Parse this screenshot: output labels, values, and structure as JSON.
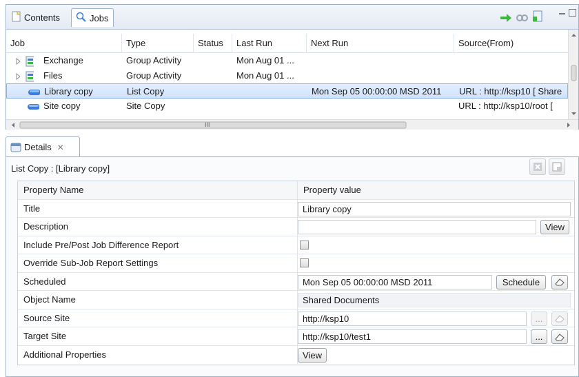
{
  "tabs": {
    "contents": "Contents",
    "jobs": "Jobs"
  },
  "columns": [
    "Job",
    "Type",
    "Status",
    "Last Run",
    "Next Run",
    "Source(From)"
  ],
  "rows": [
    {
      "job": "Exchange",
      "type": "Group Activity",
      "status": "",
      "last_run": "Mon Aug 01 ...",
      "next_run": "",
      "source": ""
    },
    {
      "job": "Files",
      "type": "Group Activity",
      "status": "",
      "last_run": "Mon Aug 01 ...",
      "next_run": "",
      "source": ""
    },
    {
      "job": "Library copy",
      "type": "List Copy",
      "status": "",
      "last_run": "",
      "next_run": "Mon Sep 05 00:00:00 MSD 2011",
      "source": "URL : http://ksp10 [ Share"
    },
    {
      "job": "Site copy",
      "type": "Site Copy",
      "status": "",
      "last_run": "",
      "next_run": "",
      "source": "URL : http://ksp10/root ["
    }
  ],
  "hscroll_mark": "III",
  "details": {
    "tab_label": "Details",
    "header": "List Copy : [Library copy]",
    "col_name": "Property Name",
    "col_value": "Property value",
    "props": {
      "title": {
        "name": "Title",
        "value": "Library copy"
      },
      "description": {
        "name": "Description",
        "value": "",
        "button": "View"
      },
      "include_diff": {
        "name": "Include Pre/Post Job Difference Report"
      },
      "override_sub": {
        "name": "Override Sub-Job Report Settings"
      },
      "scheduled": {
        "name": "Scheduled",
        "value": "Mon Sep 05 00:00:00 MSD 2011",
        "button": "Schedule"
      },
      "object_name": {
        "name": "Object Name",
        "value": "Shared Documents"
      },
      "source_site": {
        "name": "Source Site",
        "value": "http://ksp10",
        "button": "..."
      },
      "target_site": {
        "name": "Target Site",
        "value": "http://ksp10/test1",
        "button": "..."
      },
      "additional": {
        "name": "Additional Properties",
        "button": "View"
      }
    }
  },
  "colors": {
    "accent": "#3b7dd8",
    "selection": "#cfe2fb",
    "border": "#9fb1c8"
  }
}
